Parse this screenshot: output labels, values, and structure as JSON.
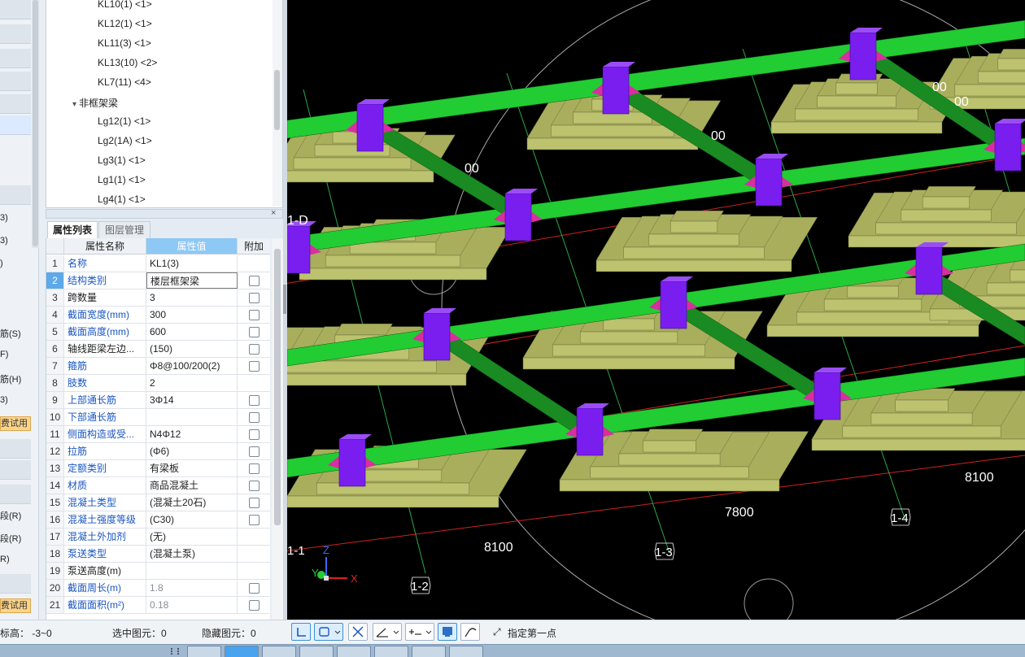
{
  "left_strip": {
    "items": [
      "3)",
      "3)",
      ")",
      "筋(S)",
      "F)",
      "筋(H)",
      "3)",
      "费试用",
      "段(R)",
      "段(R)",
      "R)",
      "费试用"
    ]
  },
  "tree": {
    "items": [
      {
        "label": "KL10(1)  <1>",
        "indent": 2
      },
      {
        "label": "KL12(1)  <1>",
        "indent": 2
      },
      {
        "label": "KL11(3)  <1>",
        "indent": 2
      },
      {
        "label": "KL13(10)  <2>",
        "indent": 2
      },
      {
        "label": "KL7(11)  <4>",
        "indent": 2
      },
      {
        "label": "非框架梁",
        "indent": 1,
        "group": true
      },
      {
        "label": "Lg12(1)  <1>",
        "indent": 2
      },
      {
        "label": "Lg2(1A)  <1>",
        "indent": 2
      },
      {
        "label": "Lg3(1)  <1>",
        "indent": 2
      },
      {
        "label": "Lg1(1)  <1>",
        "indent": 2
      },
      {
        "label": "Lg4(1)  <1>",
        "indent": 2
      }
    ],
    "collapse_glyph": "▾"
  },
  "panel": {
    "close": "×",
    "tabs": [
      "属性列表",
      "图层管理"
    ]
  },
  "grid": {
    "headers": [
      "属性名称",
      "属性值",
      "附加"
    ],
    "rows": [
      {
        "n": "1",
        "name": "名称",
        "value": "KL1(3)",
        "cb": false,
        "name_color": "blue"
      },
      {
        "n": "2",
        "name": "结构类别",
        "value": "楼层框架梁",
        "cb": true,
        "name_color": "blue",
        "selected": true
      },
      {
        "n": "3",
        "name": "跨数量",
        "value": "3",
        "cb": true,
        "name_color": "dark"
      },
      {
        "n": "4",
        "name": "截面宽度(mm)",
        "value": "300",
        "cb": true,
        "name_color": "blue"
      },
      {
        "n": "5",
        "name": "截面高度(mm)",
        "value": "600",
        "cb": true,
        "name_color": "blue"
      },
      {
        "n": "6",
        "name": "轴线距梁左边...",
        "value": "(150)",
        "cb": true,
        "name_color": "dark"
      },
      {
        "n": "7",
        "name": "箍筋",
        "value": "Φ8@100/200(2)",
        "cb": true,
        "name_color": "blue"
      },
      {
        "n": "8",
        "name": "肢数",
        "value": "2",
        "cb": false,
        "name_color": "blue"
      },
      {
        "n": "9",
        "name": "上部通长筋",
        "value": "3Φ14",
        "cb": true,
        "name_color": "blue"
      },
      {
        "n": "10",
        "name": "下部通长筋",
        "value": "",
        "cb": true,
        "name_color": "blue"
      },
      {
        "n": "11",
        "name": "侧面构造或受...",
        "value": "N4Φ12",
        "cb": true,
        "name_color": "blue"
      },
      {
        "n": "12",
        "name": "拉筋",
        "value": "(Φ6)",
        "cb": true,
        "name_color": "blue"
      },
      {
        "n": "13",
        "name": "定额类别",
        "value": "有梁板",
        "cb": true,
        "name_color": "blue"
      },
      {
        "n": "14",
        "name": "材质",
        "value": "商品混凝土",
        "cb": true,
        "name_color": "blue"
      },
      {
        "n": "15",
        "name": "混凝土类型",
        "value": "(混凝土20石)",
        "cb": true,
        "name_color": "blue"
      },
      {
        "n": "16",
        "name": "混凝土强度等级",
        "value": "(C30)",
        "cb": true,
        "name_color": "blue"
      },
      {
        "n": "17",
        "name": "混凝土外加剂",
        "value": "(无)",
        "cb": false,
        "name_color": "blue"
      },
      {
        "n": "18",
        "name": "泵送类型",
        "value": "(混凝土泵)",
        "cb": false,
        "name_color": "blue"
      },
      {
        "n": "19",
        "name": "泵送高度(m)",
        "value": "",
        "cb": false,
        "name_color": "dark"
      },
      {
        "n": "20",
        "name": "截面周长(m)",
        "value": "1.8",
        "cb": true,
        "name_color": "blue",
        "value_grey": true
      },
      {
        "n": "21",
        "name": "截面面积(m²)",
        "value": "0.18",
        "cb": true,
        "name_color": "blue",
        "value_grey": true
      }
    ]
  },
  "viewport": {
    "labels": [
      "1-D",
      "8100",
      "7800",
      "8100",
      "1-2",
      "1-3",
      "1-4",
      "1-1",
      "00",
      "00",
      "00",
      "00"
    ],
    "axis": {
      "x": "X",
      "y": "Y",
      "z": "Z"
    },
    "colors": {
      "beam": "#22cc33",
      "beam_dark": "#1a8a22",
      "column": "#7a1ef0",
      "haunch": "#d82ea0",
      "footing": "#a8ae5c",
      "footing_light": "#bcc26e",
      "axis_line": "#d22020",
      "grid_line": "#2aa84a"
    }
  },
  "status": {
    "elevation": "标高：  -3~0",
    "selected": "选中图元：0",
    "hidden": "隐藏图元：0",
    "hint": "指定第一点"
  }
}
